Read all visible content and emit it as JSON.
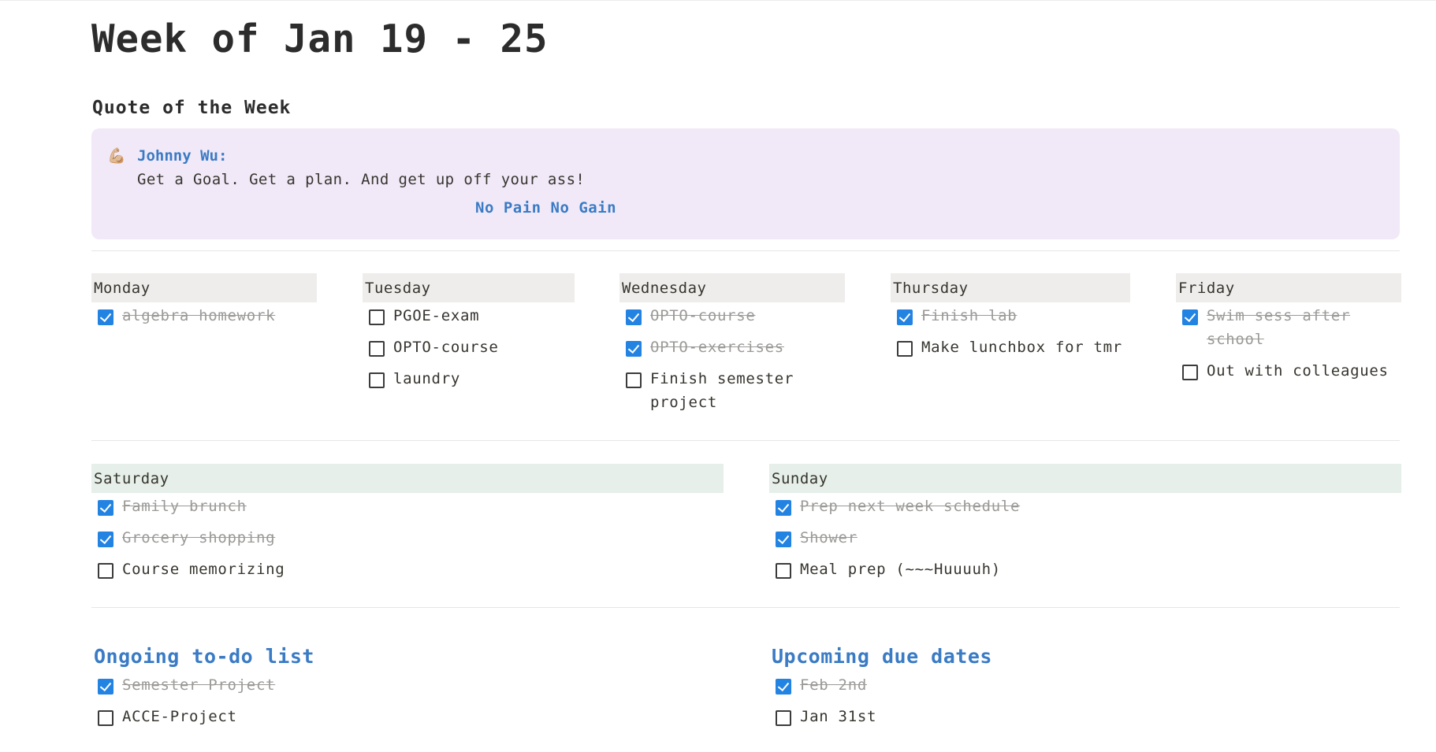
{
  "page": {
    "title": "Week of Jan 19 - 25",
    "quote_heading": "Quote of the Week"
  },
  "quote": {
    "icon": "flexed-biceps-icon",
    "icon_glyph": "💪🏼",
    "author": "Johnny Wu:",
    "text": "Get a Goal. Get a plan. And get up off your ass!",
    "motto": "No Pain No Gain",
    "background_color": "#f1e9f8",
    "accent_color": "#3a7bc5"
  },
  "weekdays": [
    {
      "name": "Monday",
      "tasks": [
        {
          "label": "algebra homework",
          "done": true
        }
      ]
    },
    {
      "name": "Tuesday",
      "tasks": [
        {
          "label": "PGOE-exam",
          "done": false
        },
        {
          "label": "OPTO-course",
          "done": false
        },
        {
          "label": "laundry",
          "done": false
        }
      ]
    },
    {
      "name": "Wednesday",
      "tasks": [
        {
          "label": "OPTO-course",
          "done": true
        },
        {
          "label": "OPTO-exercises",
          "done": true
        },
        {
          "label": "Finish semester project",
          "done": false
        }
      ]
    },
    {
      "name": "Thursday",
      "tasks": [
        {
          "label": "Finish lab",
          "done": true
        },
        {
          "label": "Make lunchbox for tmr",
          "done": false
        }
      ]
    },
    {
      "name": "Friday",
      "tasks": [
        {
          "label": "Swim sess after school",
          "done": true
        },
        {
          "label": "Out with colleagues",
          "done": false
        }
      ]
    }
  ],
  "weekend": [
    {
      "name": "Saturday",
      "tasks": [
        {
          "label": "Family brunch",
          "done": true
        },
        {
          "label": "Grocery shopping",
          "done": true
        },
        {
          "label": "Course memorizing",
          "done": false
        }
      ]
    },
    {
      "name": "Sunday",
      "tasks": [
        {
          "label": "Prep next week schedule",
          "done": true
        },
        {
          "label": "Shower",
          "done": true
        },
        {
          "label": "Meal prep (~~~Huuuuh)",
          "done": false
        }
      ]
    }
  ],
  "lists": [
    {
      "title": "Ongoing to-do list",
      "tasks": [
        {
          "label": "Semester Project",
          "done": true
        },
        {
          "label": "ACCE-Project",
          "done": false
        }
      ]
    },
    {
      "title": "Upcoming due dates",
      "tasks": [
        {
          "label": "Feb 2nd",
          "done": true
        },
        {
          "label": "Jan 31st",
          "done": false
        }
      ]
    }
  ],
  "colors": {
    "checkbox_checked": "#2383e2",
    "weekday_header_bg": "#eeedeb",
    "weekend_header_bg": "#e6efe9",
    "list_heading": "#3a7bc5",
    "done_text": "#9b9a97"
  }
}
